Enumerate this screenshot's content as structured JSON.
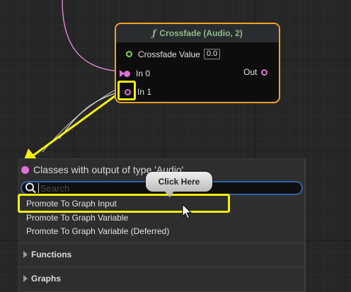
{
  "node": {
    "title": "Crossfade (Audio, 2)",
    "title_glyph": "ƒ",
    "pins": {
      "crossfade_value_label": "Crossfade Value",
      "crossfade_value": "0.0",
      "in0_label": "In 0",
      "in1_label": "In 1",
      "out_label": "Out"
    }
  },
  "menu": {
    "title": "Classes with output of type 'Audio'",
    "search_placeholder": "Search",
    "items": [
      "Promote To Graph Input",
      "Promote To Graph Variable",
      "Promote To Graph Variable (Deferred)"
    ],
    "categories": [
      "Functions",
      "Graphs"
    ]
  },
  "annotation": {
    "callout_text": "Click Here"
  },
  "colors": {
    "accent_yellow": "#f4f10a",
    "node_border": "#f2a227",
    "audio_pin": "#e06fd8",
    "float_pin": "#7fd44a",
    "search_border": "#2e62a8"
  },
  "icons": [
    "function-icon",
    "pin-icon",
    "exec-arrow-icon",
    "search-icon",
    "expand-triangle-icon",
    "mouse-cursor-icon"
  ]
}
